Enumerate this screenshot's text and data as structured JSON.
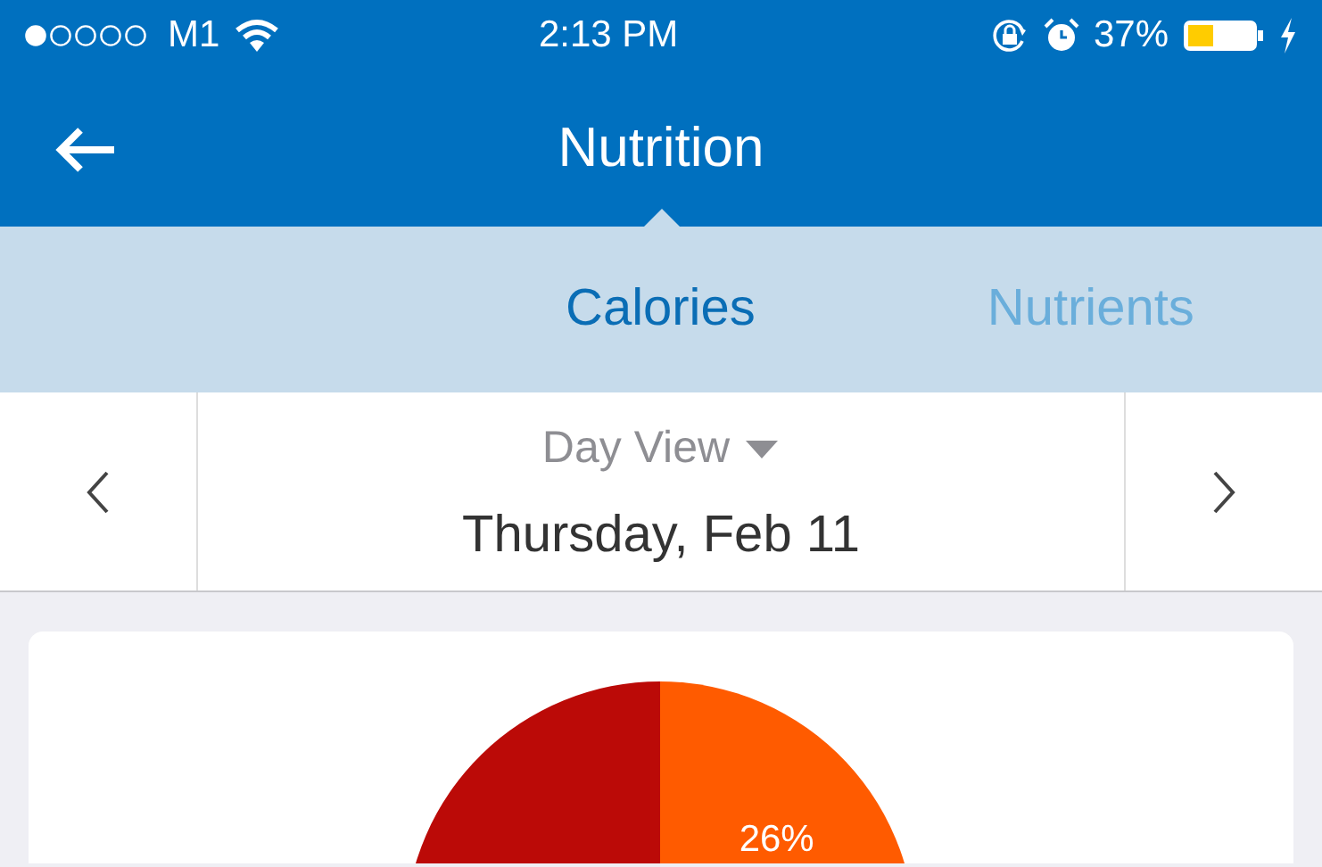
{
  "status_bar": {
    "carrier": "M1",
    "time": "2:13 PM",
    "battery": "37%"
  },
  "header": {
    "title": "Nutrition"
  },
  "tabs": [
    {
      "label": "Calories",
      "selected": true
    },
    {
      "label": "Nutrients",
      "selected": false
    }
  ],
  "date_picker": {
    "view": "Day View",
    "date": "Thursday, Feb 11"
  },
  "pie_chart": {
    "slices": [
      {
        "label": "26%",
        "color": "#ff5b00"
      },
      {
        "color": "#bb0a07"
      }
    ]
  }
}
